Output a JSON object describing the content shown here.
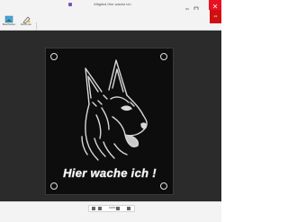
{
  "window": {
    "title": "Mitglied Hier wache ich",
    "accent_color": "#e81123"
  },
  "toolbar": {
    "items": [
      {
        "label": "Bearbeiten",
        "icon": "image-edit-icon"
      },
      {
        "label": "Zeichnen",
        "icon": "draw-icon"
      }
    ]
  },
  "thumbnail": {
    "label": "1/1"
  },
  "image": {
    "caption": "Hier wache ich !",
    "subject": "german-shepherd-head-illustration"
  },
  "statusbar": {
    "zoom": "100%",
    "tools": [
      "zoom-out-icon",
      "zoom-in-icon",
      "fit-icon",
      "rotate-icon",
      "fullscreen-icon"
    ]
  }
}
